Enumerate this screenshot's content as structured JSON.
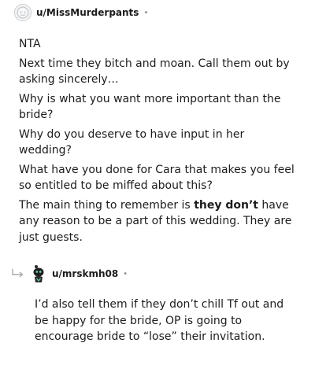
{
  "comment1": {
    "username": "u/MissMurderpants",
    "dot": "•",
    "paragraphs": {
      "p1": "NTA",
      "p2": "Next time they bitch and moan. Call them out by asking sincerely…",
      "p3": "Why is what you want more important than the bride?",
      "p4": "Why do you deserve to have input in her wedding?",
      "p5": "What have you done for Cara that makes you feel so entitled to be miffed about this?",
      "p6_before": "The main thing to remember is ",
      "p6_bold": "they don’t",
      "p6_after": " have any reason to be a part of this wedding. They are just guests."
    }
  },
  "comment2": {
    "username": "u/mrskmh08",
    "dot": "•",
    "text": "I’d also tell them if they don’t chill Tf out and be happy for the bride, OP is going to encourage bride to “lose” their invitation."
  },
  "icons": {
    "avatar1": "snoo-avatar-placeholder-icon",
    "avatar2": "snoo-avatar-icon",
    "reply": "reply-arrow-icon"
  }
}
